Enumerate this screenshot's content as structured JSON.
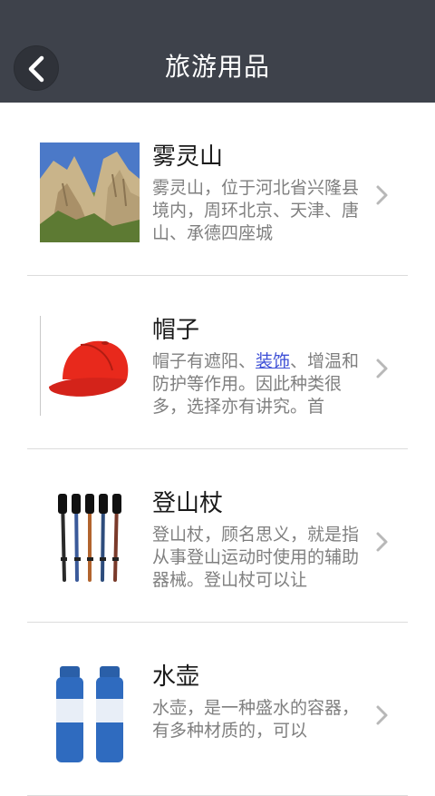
{
  "header": {
    "title": "旅游用品",
    "back_icon": "chevron-left-icon"
  },
  "items": [
    {
      "title": "雾灵山",
      "description": "雾灵山，位于河北省兴隆县境内，周环北京、天津、唐山、承德四座城",
      "image": "mountain-photo"
    },
    {
      "title": "帽子",
      "desc_before": "帽子有遮阳、",
      "desc_link": "装饰",
      "desc_after": "、增温和防护等作用。因此种类很多，选择亦有讲究。首",
      "image": "red-cap-photo"
    },
    {
      "title": "登山杖",
      "description": "登山杖，顾名思义，就是指从事登山运动时使用的辅助器械。登山杖可以让",
      "image": "trekking-poles-photo"
    },
    {
      "title": "水壶",
      "description": "水壶，是一种盛水的容器，有多种材质的，可以",
      "image": "water-bottles-photo"
    }
  ],
  "colors": {
    "topbar": "#3e424b",
    "text_title": "#1a1a1a",
    "text_desc": "#7f7f7f",
    "link": "#3d4fd6",
    "divider": "#dcdcdc"
  }
}
